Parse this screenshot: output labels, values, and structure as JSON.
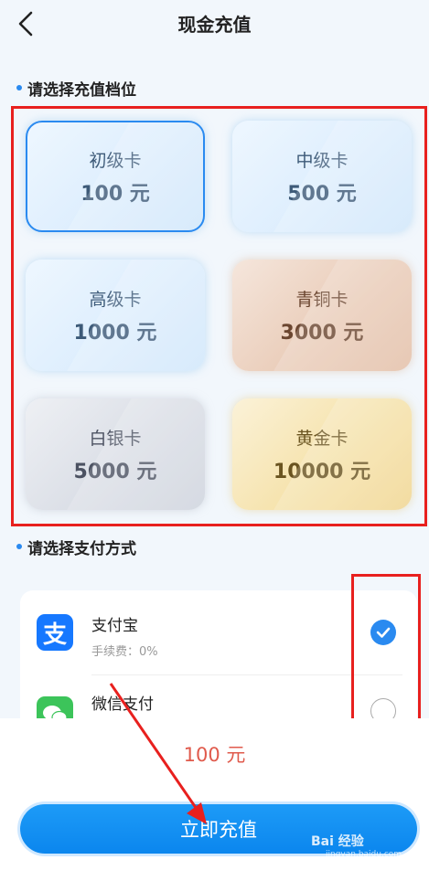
{
  "header": {
    "title": "现金充值"
  },
  "sections": {
    "tier_label": "请选择充值档位",
    "pay_label": "请选择支付方式"
  },
  "cards": [
    {
      "name": "初级卡",
      "amount": "100 元",
      "style": "blue",
      "selected": true
    },
    {
      "name": "中级卡",
      "amount": "500 元",
      "style": "blue",
      "selected": false
    },
    {
      "name": "高级卡",
      "amount": "1000 元",
      "style": "blue",
      "selected": false
    },
    {
      "name": "青铜卡",
      "amount": "3000 元",
      "style": "bronze",
      "selected": false
    },
    {
      "name": "白银卡",
      "amount": "5000 元",
      "style": "silver",
      "selected": false
    },
    {
      "name": "黄金卡",
      "amount": "10000 元",
      "style": "gold",
      "selected": false
    }
  ],
  "payments": [
    {
      "icon": "alipay-icon",
      "name": "支付宝",
      "fee": "手续费：0%",
      "checked": true,
      "color": "#1678ff"
    },
    {
      "icon": "wechat-icon",
      "name": "微信支付",
      "checked": false,
      "color": "#3cc45a"
    }
  ],
  "footer": {
    "total": "100 元",
    "submit_label": "立即充值"
  },
  "watermark": {
    "text": "Bai 经验",
    "sub": "jingyan.baidu.com"
  },
  "colors": {
    "accent": "#2a8af0",
    "highlight": "#e8201e",
    "total": "#e05a4c"
  }
}
